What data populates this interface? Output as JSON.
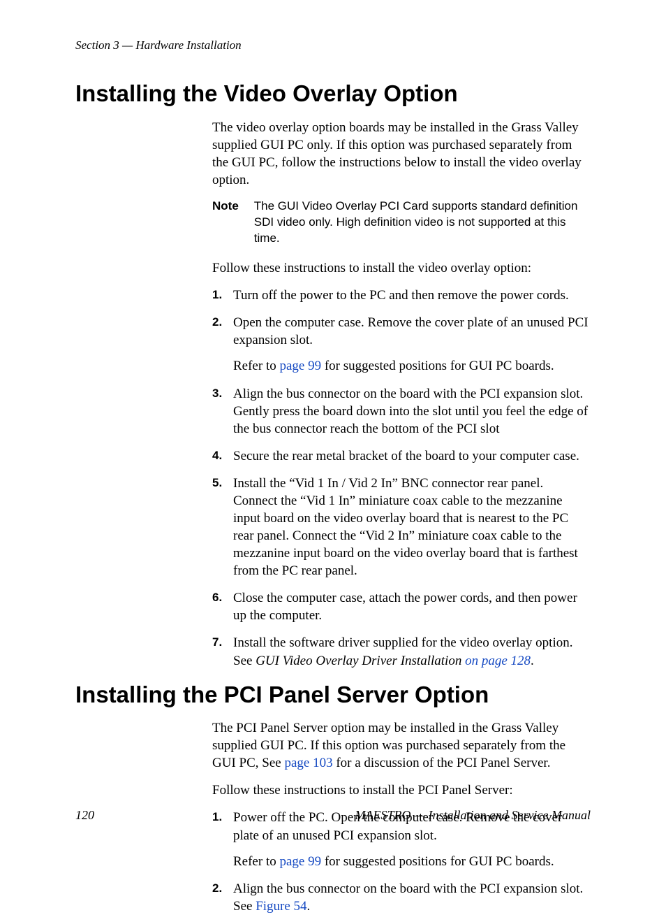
{
  "header": {
    "running": "Section 3 — Hardware Installation"
  },
  "section1": {
    "title": "Installing the Video Overlay Option",
    "intro": "The video overlay option boards may be installed in the Grass Valley sup­plied GUI PC only. If this option was purchased separately from the GUI PC, follow the instructions below to install the video overlay option.",
    "note_label": "Note",
    "note_body": "The GUI Video Overlay PCI Card supports standard definition SDI video only. High definition video is not supported at this time.",
    "lead2": "Follow these instructions to install the video overlay option:",
    "steps": {
      "s1": "Turn off the power to the PC and then remove the power cords.",
      "s2": "Open the computer case. Remove the cover plate of an unused PCI expansion slot.",
      "s2_sub_a": "Refer to ",
      "s2_sub_link": "page 99",
      "s2_sub_b": " for suggested positions for GUI PC boards.",
      "s3": "Align the bus connector on the board with the PCI expansion slot. Gently press the board down into the slot until you feel the edge of the bus connector reach the bottom of the PCI slot",
      "s4": "Secure the rear metal bracket of the board to your computer case.",
      "s5": "Install the “Vid 1 In / Vid 2 In” BNC connector rear panel. Connect the “Vid 1 In” miniature coax cable to the mezzanine input board on the video overlay board that is nearest to the PC rear panel. Connect the “Vid 2 In” miniature coax cable to the mezzanine input board on the video overlay board that is farthest from the PC rear panel.",
      "s6": "Close the computer case, attach the power cords, and then power up the computer.",
      "s7_a": "Install the software driver supplied for the video overlay option. See ",
      "s7_ital": "GUI Video Overlay Driver Installation ",
      "s7_link": "on page 128",
      "s7_b": "."
    }
  },
  "section2": {
    "title": "Installing the PCI Panel Server Option",
    "intro_a": "The PCI Panel Server option may be installed in the Grass Valley supplied GUI PC. If this option was purchased separately from the GUI PC, See ",
    "intro_link": "page 103",
    "intro_b": " for a discussion of the PCI Panel Server.",
    "lead2": "Follow these instructions to install the PCI Panel Server:",
    "steps": {
      "s1": "Power off the PC. Open the computer case. Remove the cover plate of an unused PCI expansion slot.",
      "s1_sub_a": "Refer to ",
      "s1_sub_link": "page 99",
      "s1_sub_b": " for suggested positions for GUI PC boards.",
      "s2_a": "Align the bus connector on the board with the PCI expansion slot. See ",
      "s2_link": "Figure 54",
      "s2_b": "."
    }
  },
  "footer": {
    "page": "120",
    "doc": "MAESTRO  —  Installation and Service Manual"
  }
}
